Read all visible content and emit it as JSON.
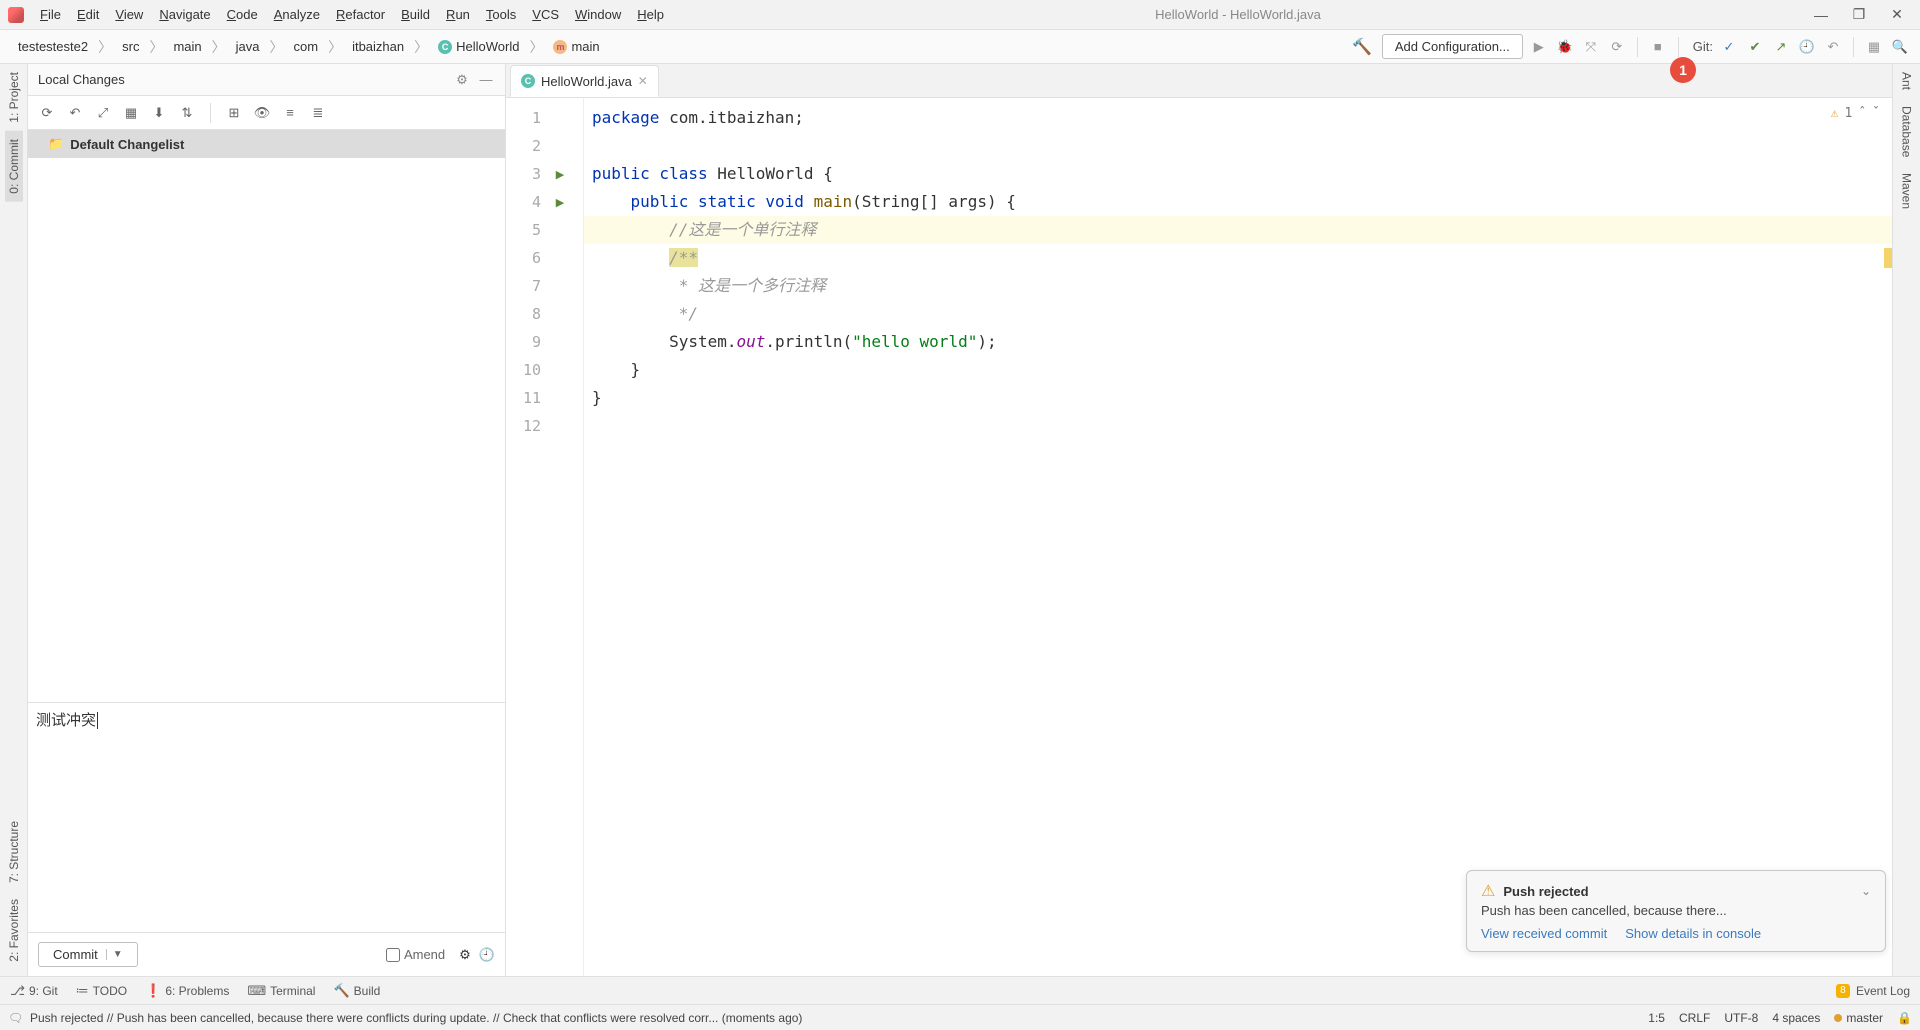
{
  "titlebar": {
    "menus": [
      "File",
      "Edit",
      "View",
      "Navigate",
      "Code",
      "Analyze",
      "Refactor",
      "Build",
      "Run",
      "Tools",
      "VCS",
      "Window",
      "Help"
    ],
    "title": "HelloWorld - HelloWorld.java"
  },
  "breadcrumbs": [
    "testesteste2",
    "src",
    "main",
    "java",
    "com",
    "itbaizhan",
    "HelloWorld",
    "main"
  ],
  "toolbar": {
    "add_config": "Add Configuration...",
    "git_label": "Git:"
  },
  "commit_panel": {
    "title": "Local Changes",
    "changelist": "Default Changelist",
    "message": "测试冲突",
    "commit_btn": "Commit",
    "amend": "Amend"
  },
  "editor": {
    "tab_label": "HelloWorld.java",
    "warn_count": "1",
    "lines": [
      {
        "n": "1",
        "html": [
          {
            "t": "package ",
            "c": "kw"
          },
          {
            "t": "com.itbaizhan;",
            "c": ""
          }
        ]
      },
      {
        "n": "2",
        "html": []
      },
      {
        "n": "3",
        "run": true,
        "html": [
          {
            "t": "public class ",
            "c": "kw"
          },
          {
            "t": "HelloWorld {",
            "c": "cls"
          }
        ]
      },
      {
        "n": "4",
        "run": true,
        "html": [
          {
            "t": "    public static void ",
            "c": "kw"
          },
          {
            "t": "main",
            "c": "fn"
          },
          {
            "t": "(String[] args) {",
            "c": ""
          }
        ]
      },
      {
        "n": "5",
        "hl": true,
        "html": [
          {
            "t": "        //这是一个单行注释",
            "c": "cmt"
          }
        ]
      },
      {
        "n": "6",
        "html": [
          {
            "t": "        ",
            "c": ""
          },
          {
            "t": "/**",
            "c": "cmt-doc doc-hl"
          }
        ]
      },
      {
        "n": "7",
        "html": [
          {
            "t": "         * 这是一个多行注释",
            "c": "cmt-doc"
          }
        ]
      },
      {
        "n": "8",
        "html": [
          {
            "t": "         */",
            "c": "cmt-doc"
          }
        ]
      },
      {
        "n": "9",
        "html": [
          {
            "t": "        System.",
            "c": ""
          },
          {
            "t": "out",
            "c": "field"
          },
          {
            "t": ".println(",
            "c": ""
          },
          {
            "t": "\"hello world\"",
            "c": "str"
          },
          {
            "t": ");",
            "c": ""
          }
        ]
      },
      {
        "n": "10",
        "html": [
          {
            "t": "    }",
            "c": ""
          }
        ]
      },
      {
        "n": "11",
        "html": [
          {
            "t": "}",
            "c": ""
          }
        ]
      },
      {
        "n": "12",
        "html": []
      }
    ],
    "red_badge": "1"
  },
  "left_tabs": {
    "project": "1: Project",
    "commit": "0: Commit",
    "structure": "7: Structure",
    "favorites": "2: Favorites"
  },
  "right_tabs": {
    "ant": "Ant",
    "database": "Database",
    "maven": "Maven"
  },
  "notif": {
    "title": "Push rejected",
    "body": "Push has been cancelled, because there...",
    "link1": "View received commit",
    "link2": "Show details in console"
  },
  "bottom_tabs": {
    "git": "9: Git",
    "todo": "TODO",
    "problems": "6: Problems",
    "terminal": "Terminal",
    "build": "Build",
    "event_log": "Event Log",
    "event_badge": "8"
  },
  "statusbar": {
    "msg": "Push rejected // Push has been cancelled, because there were conflicts during update. // Check that conflicts were resolved corr... (moments ago)",
    "pos": "1:5",
    "eol": "CRLF",
    "enc": "UTF-8",
    "indent": "4 spaces",
    "branch": "master"
  }
}
